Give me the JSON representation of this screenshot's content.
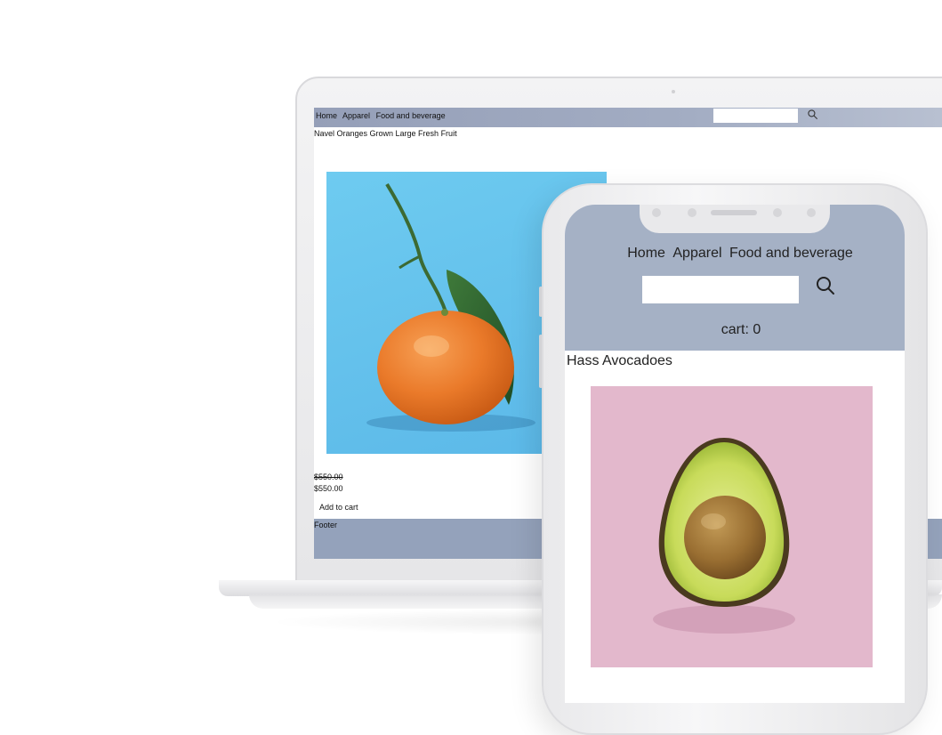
{
  "desktop": {
    "nav": {
      "links": [
        "Home",
        "Apparel",
        "Food and beverage"
      ],
      "search_placeholder": ""
    },
    "product": {
      "title": "Navel Oranges Grown Large Fresh Fruit",
      "price_original": "$550.00",
      "price_current": "$550.00",
      "add_to_cart_label": "Add to cart"
    },
    "footer_text": "Footer"
  },
  "mobile": {
    "nav": {
      "links": [
        "Home",
        "Apparel",
        "Food and beverage"
      ],
      "search_placeholder": ""
    },
    "cart_label": "cart: 0",
    "product": {
      "title": "Hass Avocadoes"
    }
  },
  "icons": {
    "search": "search-icon"
  },
  "colors": {
    "nav_bg": "#a5b1c5",
    "footer_bg": "#94a2bb",
    "orange_bg": "#5bb8e8",
    "avocado_bg": "#e3b8cc"
  }
}
